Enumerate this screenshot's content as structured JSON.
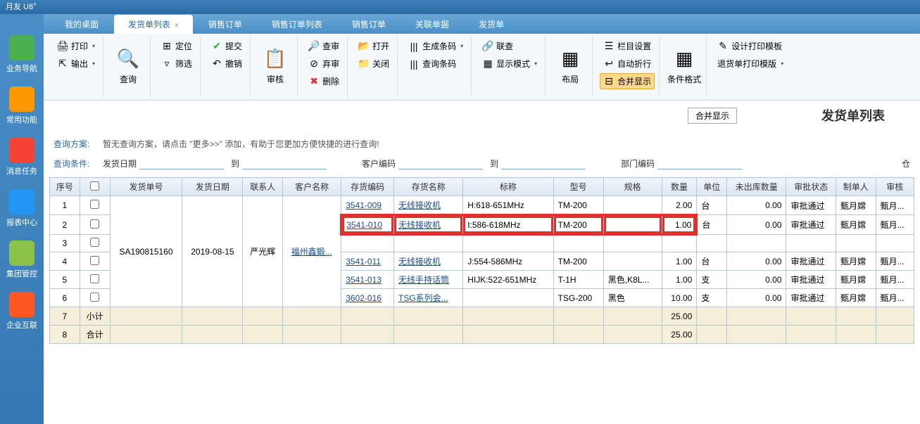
{
  "app_title": "月友 U8",
  "sidebar": [
    {
      "label": "业务导航",
      "color": "#4caf50"
    },
    {
      "label": "常用功能",
      "color": "#ff9800"
    },
    {
      "label": "消息任务",
      "color": "#f44336"
    },
    {
      "label": "报表中心",
      "color": "#2196f3"
    },
    {
      "label": "集团管控",
      "color": "#8bc34a"
    },
    {
      "label": "企业互联",
      "color": "#ff5722"
    }
  ],
  "tabs": [
    {
      "label": "我的桌面",
      "active": false
    },
    {
      "label": "发货单列表",
      "active": true,
      "closable": true
    },
    {
      "label": "销售订单",
      "active": false
    },
    {
      "label": "销售订单列表",
      "active": false
    },
    {
      "label": "销售订单",
      "active": false
    },
    {
      "label": "关联单据",
      "active": false
    },
    {
      "label": "发货单",
      "active": false
    }
  ],
  "ribbon": {
    "print": "打印",
    "output": "输出",
    "query": "查询",
    "locate": "定位",
    "filter": "筛选",
    "submit": "提交",
    "cancel_submit": "撤销",
    "audit": "审核",
    "check": "查审",
    "abandon": "弃审",
    "delete": "删除",
    "open": "打开",
    "close": "关闭",
    "gencode": "生成条码",
    "querycode": "查询条码",
    "linkquery": "联查",
    "dispmode": "显示模式",
    "layout": "布局",
    "colset": "栏目设置",
    "autowrap": "自动折行",
    "mergedisp": "合并显示",
    "condfmt": "条件格式",
    "designprint": "设计打印模板",
    "returnprint": "退货单打印模版"
  },
  "combine_btn": "合并显示",
  "page_title": "发货单列表",
  "query_scheme_label": "查询方案:",
  "query_scheme_tip": "暂无查询方案，请点击 \"更多>>\" 添加，有助于您更加方便快捷的进行查询!",
  "query_cond_label": "查询条件:",
  "fields": {
    "ship_date": "发货日期",
    "to": "到",
    "cust_code": "客户编码",
    "to2": "到",
    "dept_code": "部门编码",
    "warehouse": "仓"
  },
  "columns": [
    "序号",
    "",
    "发货单号",
    "发货日期",
    "联系人",
    "客户名称",
    "存货编码",
    "存货名称",
    "标称",
    "型号",
    "规格",
    "数量",
    "单位",
    "未出库数量",
    "审批状态",
    "制单人",
    "审核"
  ],
  "merged": {
    "ship_no": "SA190815160",
    "ship_date": "2019-08-15",
    "contact": "严光辉",
    "cust": "福州鑫鍛..."
  },
  "rows": [
    {
      "seq": "1",
      "code": "3541-009",
      "name": "无线接收机",
      "spec": "H:618-651MHz",
      "model": "TM-200",
      "std": "",
      "qty": "2.00",
      "unit": "台",
      "unship": "0.00",
      "status": "审批通过",
      "maker": "甄月嫦",
      "auditor": "甄月..."
    },
    {
      "seq": "2",
      "code": "3541-010",
      "name": "无线接收机",
      "spec": "I:586-618MHz",
      "model": "TM-200",
      "std": "",
      "qty": "1.00",
      "unit": "台",
      "unship": "0.00",
      "status": "审批通过",
      "maker": "甄月嫦",
      "auditor": "甄月...",
      "hl": true
    },
    {
      "seq": "3",
      "code": "",
      "name": "",
      "spec": "",
      "model": "",
      "std": "",
      "qty": "",
      "unit": "",
      "unship": "",
      "status": "",
      "maker": "",
      "auditor": ""
    },
    {
      "seq": "4",
      "code": "3541-011",
      "name": "无线接收机",
      "spec": "J:554-586MHz",
      "model": "TM-200",
      "std": "",
      "qty": "1.00",
      "unit": "台",
      "unship": "0.00",
      "status": "审批通过",
      "maker": "甄月嫦",
      "auditor": "甄月..."
    },
    {
      "seq": "5",
      "code": "3541-013",
      "name": "无线手持话筒",
      "spec": "HIJK:522-651MHz",
      "model": "T-1H",
      "std": "黑色,K8L...",
      "qty": "1.00",
      "unit": "支",
      "unship": "0.00",
      "status": "审批通过",
      "maker": "甄月嫦",
      "auditor": "甄月..."
    },
    {
      "seq": "6",
      "code": "3602-016",
      "name": "TSG系列会...",
      "spec": "",
      "model": "TSG-200",
      "std": "黑色",
      "qty": "10.00",
      "unit": "支",
      "unship": "0.00",
      "status": "审批通过",
      "maker": "甄月嫦",
      "auditor": "甄月..."
    }
  ],
  "subtotal": {
    "seq": "7",
    "label": "小计",
    "qty": "25.00"
  },
  "total": {
    "seq": "8",
    "label": "合计",
    "qty": "25.00"
  }
}
